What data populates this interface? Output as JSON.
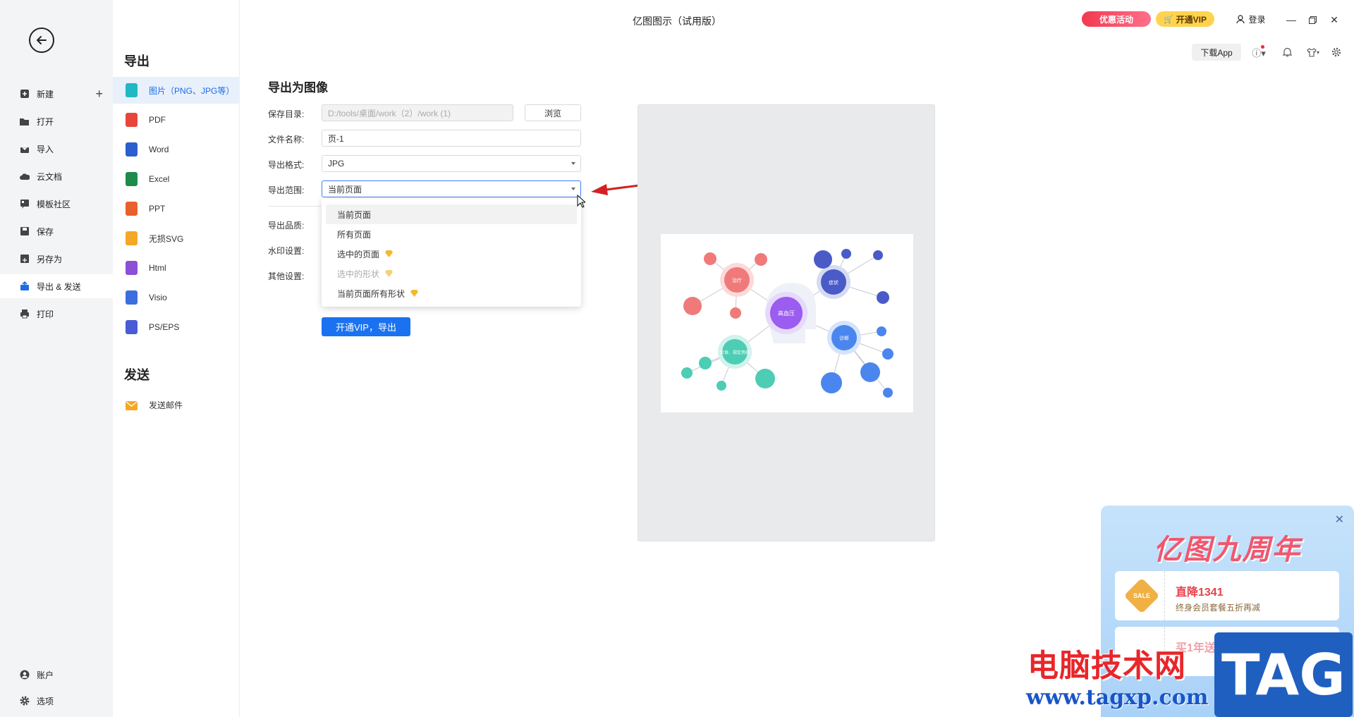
{
  "window": {
    "title": "亿图图示（试用版）"
  },
  "header": {
    "promo_label": "优惠活动",
    "vip_label": "开通VIP",
    "login_label": "登录",
    "download_app": "下载App",
    "colors": {
      "promo": "#f2394f",
      "vip": "#ffd34d"
    }
  },
  "nav": {
    "items": [
      {
        "label": "新建",
        "icon": "plus-square-icon"
      },
      {
        "label": "打开",
        "icon": "folder-icon"
      },
      {
        "label": "导入",
        "icon": "import-icon"
      },
      {
        "label": "云文档",
        "icon": "cloud-icon"
      },
      {
        "label": "模板社区",
        "icon": "template-icon"
      },
      {
        "label": "保存",
        "icon": "save-icon"
      },
      {
        "label": "另存为",
        "icon": "save-as-icon"
      },
      {
        "label": "导出 & 发送",
        "icon": "export-icon",
        "active": true
      },
      {
        "label": "打印",
        "icon": "print-icon"
      }
    ],
    "bottom": [
      {
        "label": "账户",
        "icon": "account-icon"
      },
      {
        "label": "选项",
        "icon": "gear-icon"
      }
    ]
  },
  "export": {
    "section_title": "导出",
    "types": [
      {
        "label": "图片（PNG、JPG等）",
        "icon": "image-file-icon",
        "color": "#1fb8c4",
        "active": true
      },
      {
        "label": "PDF",
        "icon": "pdf-file-icon",
        "color": "#e8463a"
      },
      {
        "label": "Word",
        "icon": "word-file-icon",
        "color": "#2b5fcf"
      },
      {
        "label": "Excel",
        "icon": "excel-file-icon",
        "color": "#1e8a4c"
      },
      {
        "label": "PPT",
        "icon": "ppt-file-icon",
        "color": "#e8612c"
      },
      {
        "label": "无损SVG",
        "icon": "svg-file-icon",
        "color": "#f3a826"
      },
      {
        "label": "Html",
        "icon": "html-file-icon",
        "color": "#8c4fd6"
      },
      {
        "label": "Visio",
        "icon": "visio-file-icon",
        "color": "#3b6fe0"
      },
      {
        "label": "PS/EPS",
        "icon": "eps-file-icon",
        "color": "#4a5bd6"
      }
    ],
    "send_title": "发送",
    "send_items": [
      {
        "label": "发送邮件",
        "icon": "mail-icon",
        "color": "#f3a826"
      }
    ]
  },
  "form": {
    "title": "导出为图像",
    "save_dir_label": "保存目录:",
    "save_dir_value": "D:/tools/桌面/work（2）/work (1)",
    "browse": "浏览",
    "filename_label": "文件名称:",
    "filename_value": "页-1",
    "format_label": "导出格式:",
    "format_value": "JPG",
    "range_label": "导出范围:",
    "range_value": "当前页面",
    "quality_label": "导出品质:",
    "watermark_label": "水印设置:",
    "other_label": "其他设置:",
    "range_options": [
      {
        "label": "当前页面",
        "selected": true,
        "vip": false,
        "disabled": false
      },
      {
        "label": "所有页面",
        "selected": false,
        "vip": false,
        "disabled": false
      },
      {
        "label": "选中的页面",
        "selected": false,
        "vip": true,
        "disabled": false
      },
      {
        "label": "选中的形状",
        "selected": false,
        "vip": true,
        "disabled": true
      },
      {
        "label": "当前页面所有形状",
        "selected": false,
        "vip": true,
        "disabled": false
      }
    ],
    "export_button": "开通VIP，导出"
  },
  "preview": {
    "center_label": "高血压",
    "nodes": [
      "治疗",
      "症状",
      "诊断",
      "饮食、规定用药"
    ]
  },
  "promo": {
    "title": "亿图九周年",
    "card1_title": "直降1341",
    "card1_sub": "终身会员套餐五折再减",
    "card2_title": "买1年送半年",
    "sale_badge": "SALE"
  },
  "watermark": {
    "text": "电脑技术网",
    "url": "www.tagxp.com",
    "tag": "TAG"
  }
}
